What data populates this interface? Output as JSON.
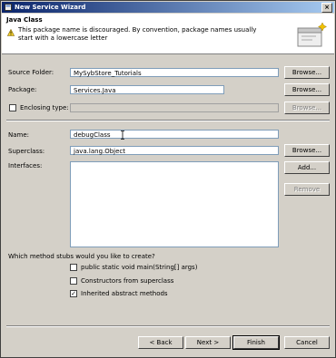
{
  "window": {
    "title": "New Service Wizard",
    "close_glyph": "×"
  },
  "banner": {
    "heading": "Java Class",
    "message": "This package name is discouraged. By convention, package names usually start with a lowercase letter",
    "warning_icon": "warning-icon",
    "wizard_icon": "class-wizard-icon"
  },
  "form": {
    "source_folder": {
      "label": "Source Folder:",
      "value": "MySybStore_Tutorials",
      "browse": "Browse..."
    },
    "package": {
      "label": "Package:",
      "value": "Services.Java",
      "browse": "Browse..."
    },
    "enclosing": {
      "label": "Enclosing type:",
      "value": "",
      "browse": "Browse...",
      "checked": false
    },
    "name": {
      "label": "Name:",
      "value": "debugClass"
    },
    "superclass": {
      "label": "Superclass:",
      "value": "java.lang.Object",
      "browse": "Browse..."
    },
    "interfaces": {
      "label": "Interfaces:",
      "add": "Add...",
      "remove": "Remove"
    }
  },
  "stubs": {
    "question": "Which method stubs would you like to create?",
    "options": [
      {
        "label": "public static void main(String[] args)",
        "checked": false
      },
      {
        "label": "Constructors from superclass",
        "checked": false
      },
      {
        "label": "Inherited abstract methods",
        "checked": true
      }
    ],
    "check_glyph": "✓"
  },
  "buttons": {
    "back": "< Back",
    "next": "Next >",
    "finish": "Finish",
    "cancel": "Cancel"
  }
}
